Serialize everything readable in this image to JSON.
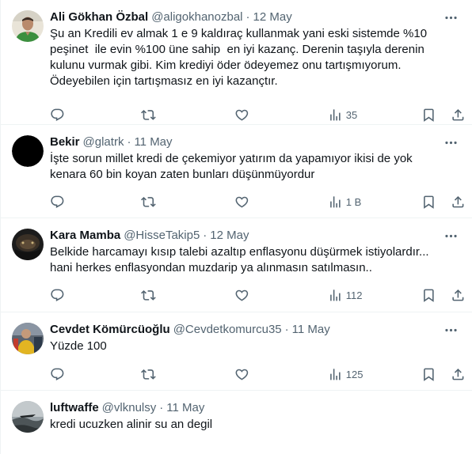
{
  "tweets": [
    {
      "name": "Ali Gökhan Özbal",
      "handle": "@aligokhanozbal",
      "separator": "·",
      "date": "12 May",
      "text": "Şu an Kredili ev almak 1 e 9 kaldıraç kullanmak yani eski sistemde %10\npeşinet  ile evin %100 üne sahip  en iyi kazanç. Derenin taşıyla derenin\nkulunu vurmak gibi. Kim krediyi öder ödeyemez onu tartışmıyorum.\nÖdeyebilen için tartışmasız en iyi kazançtır.",
      "views": "35",
      "avatar_icon": "avatar-man-green-sweater"
    },
    {
      "name": "Bekir",
      "handle": "@glatrk",
      "separator": "·",
      "date": "11 May",
      "text": "İşte sorun millet kredi de çekemiyor yatırım da yapamıyor ikisi de yok\nkenara 60 bin koyan zaten bunları düşünmüyordur",
      "views": "1 B",
      "avatar_icon": "avatar-black"
    },
    {
      "name": "Kara Mamba",
      "handle": "@HisseTakip5",
      "separator": "·",
      "date": "12 May",
      "text": "Belkide harcamayı kısıp talebi azaltıp enflasyonu düşürmek istiyolardır...\nhani herkes enflasyondan muzdarip ya alınmasın satılmasın..",
      "views": "112",
      "avatar_icon": "avatar-black-mamba"
    },
    {
      "name": "Cevdet Kömürcüoğlu",
      "handle": "@Cevdetkomurcu35",
      "separator": "·",
      "date": "11 May",
      "text": "Yüzde 100",
      "views": "125",
      "avatar_icon": "avatar-person-yellow"
    },
    {
      "name": "luftwaffe",
      "handle": "@vlknulsy",
      "separator": "·",
      "date": "11 May",
      "text": "kredi ucuzken alinir su an degil",
      "views": "",
      "avatar_icon": "avatar-grey-landscape"
    }
  ],
  "icons": {
    "more": "more-dots-icon",
    "reply": "reply-icon",
    "retweet": "retweet-icon",
    "like": "heart-icon",
    "views": "views-chart-icon",
    "bookmark": "bookmark-icon",
    "share": "share-icon"
  },
  "colors": {
    "text": "#0f1419",
    "muted": "#536471",
    "border": "#eff3f4"
  }
}
